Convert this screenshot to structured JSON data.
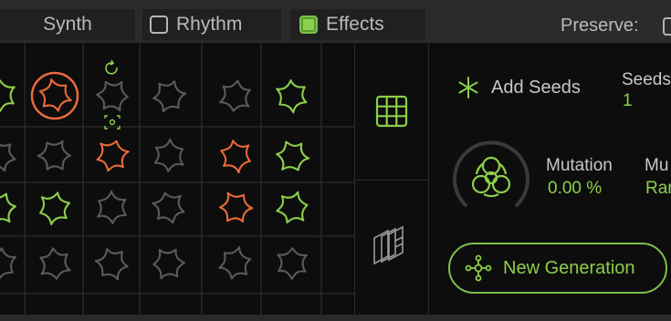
{
  "tabs": [
    {
      "label": "Synth",
      "checked": null
    },
    {
      "label": "Rhythm",
      "checked": false
    },
    {
      "label": "Effects",
      "checked": true
    }
  ],
  "preserve": {
    "label": "Preserve:",
    "checked": false
  },
  "seeds": {
    "add_label": "Add Seeds",
    "count_label": "Seeds",
    "count_value": "1"
  },
  "mutation": {
    "label": "Mutation",
    "value": "0.00 %"
  },
  "mutation_mode": {
    "label": "Mu",
    "value": "Rar"
  },
  "new_generation": {
    "label": "New Generation"
  },
  "grid": {
    "rows": [
      [
        "green",
        "orange-selected",
        "gray",
        "gray",
        "gray",
        "green"
      ],
      [
        "gray",
        "gray",
        "orange",
        "gray",
        "orange",
        "green"
      ],
      [
        "green",
        "green",
        "gray",
        "gray",
        "orange",
        "green"
      ],
      [
        "gray",
        "gray",
        "gray",
        "gray",
        "gray",
        "gray"
      ]
    ]
  },
  "colors": {
    "accent_green": "#8ccf4a",
    "accent_orange": "#e96a3a",
    "cell_gray": "#5a5a5a"
  },
  "icons": {
    "add_seeds": "asterisk-icon",
    "mutation": "biohazard-icon",
    "new_generation": "molecule-icon",
    "grid_view": "grid-icon",
    "stack_view": "stacked-layers-icon",
    "refresh": "refresh-icon",
    "focus": "focus-icon"
  }
}
